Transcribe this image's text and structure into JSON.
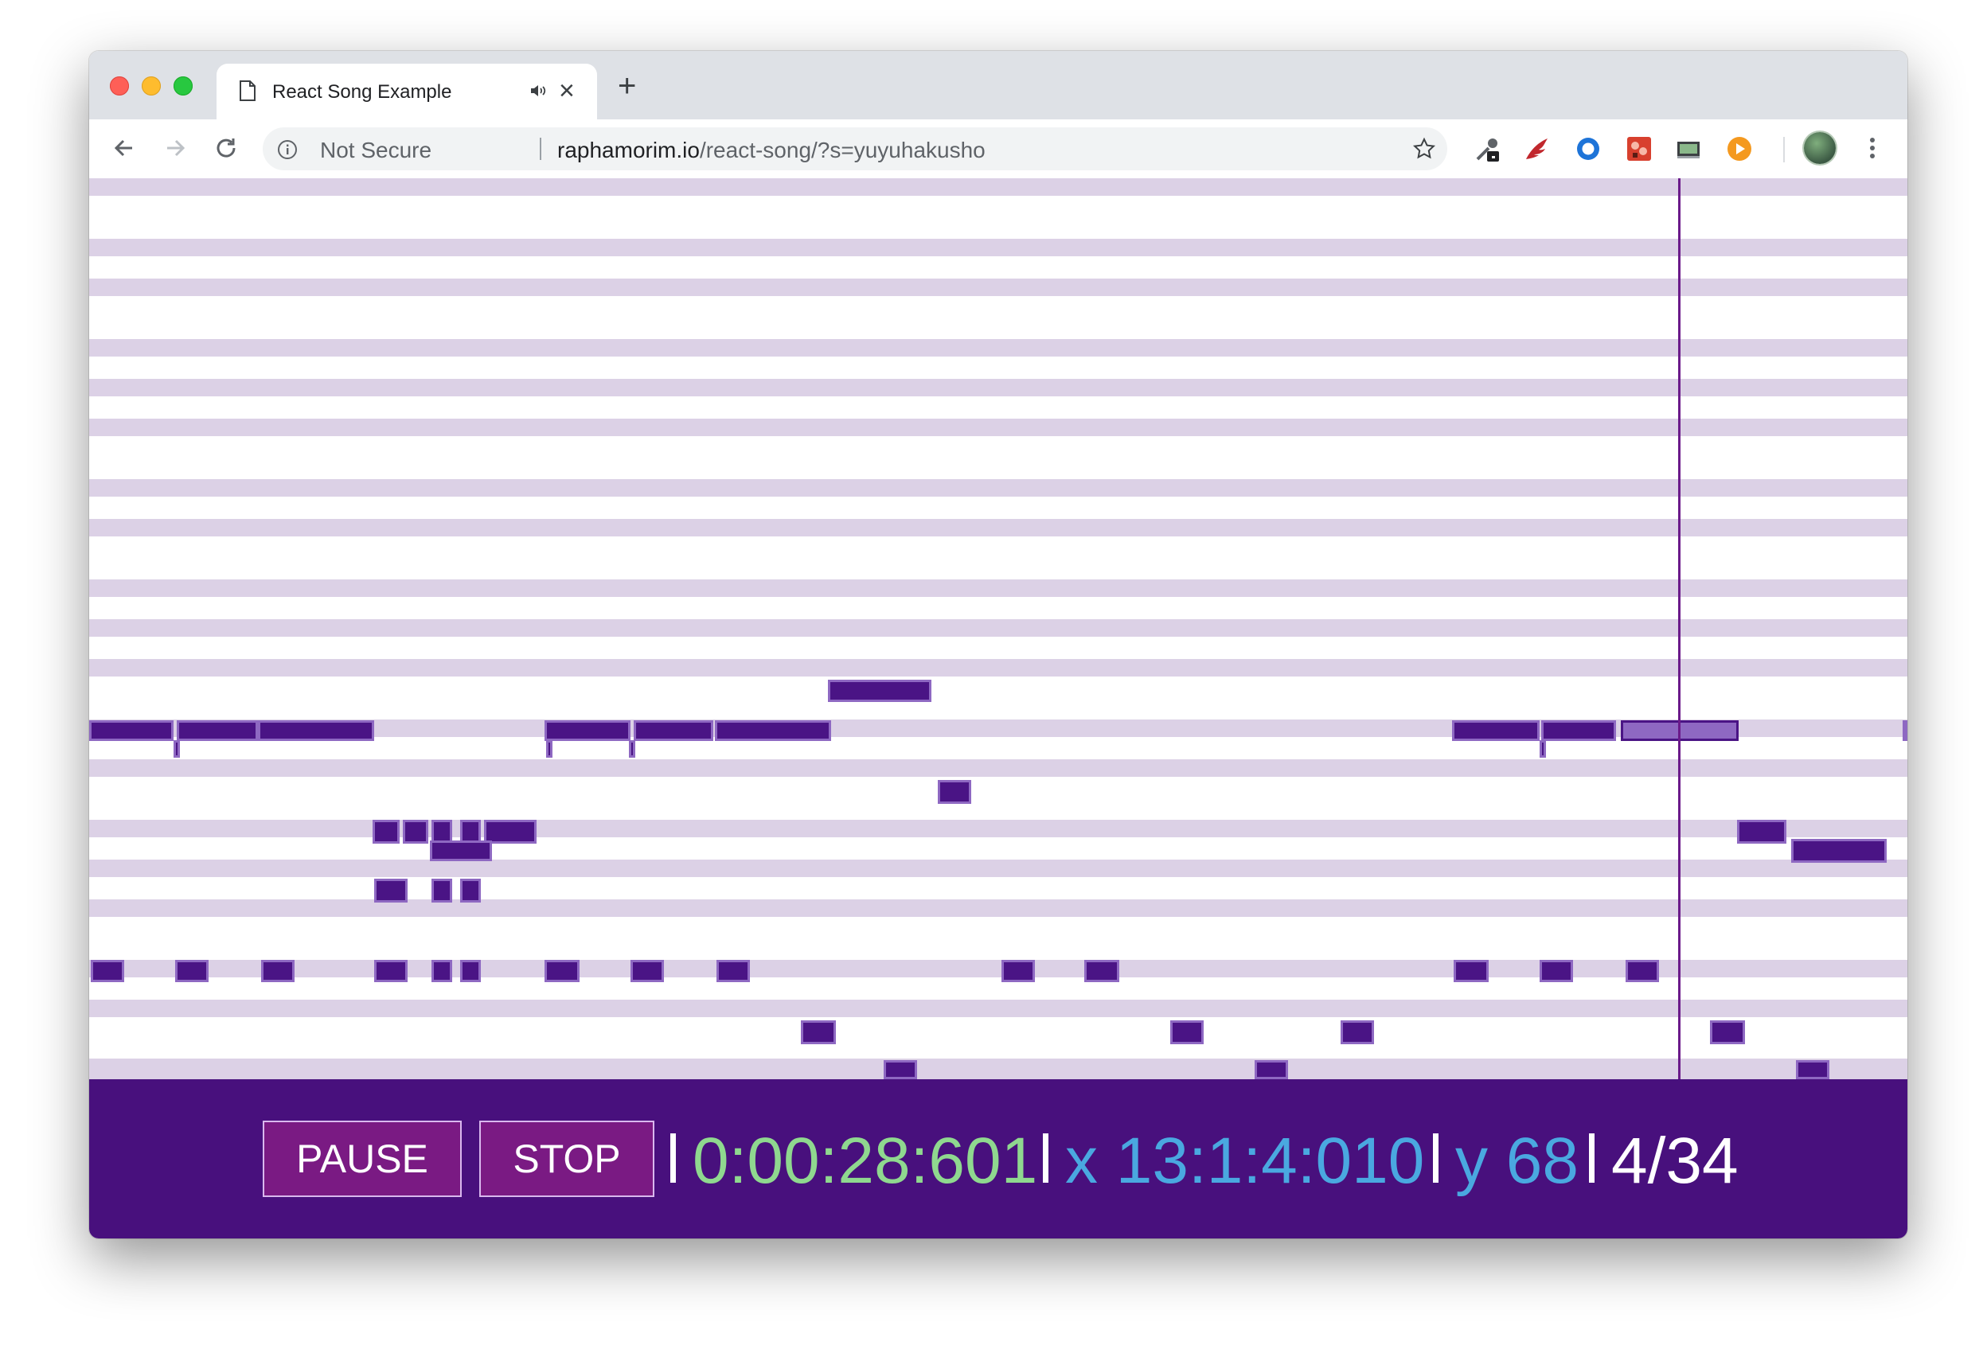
{
  "browser": {
    "tab": {
      "title": "React Song Example",
      "favicon": "page-icon",
      "audio_icon": "speaker-icon",
      "close_icon": "close-icon"
    },
    "new_tab_label": "+",
    "security_label": "Not Secure",
    "url_host": "raphamorim.io",
    "url_path": "/react-song/?s=yuyuhakusho",
    "nav_icons": [
      "back-arrow-icon",
      "forward-arrow-icon",
      "reload-icon"
    ],
    "extensions": [
      "eyedropper-icon",
      "wing-icon",
      "circle-icon",
      "sprite-icon",
      "monitor-icon",
      "play-icon"
    ]
  },
  "piano_roll": {
    "colors": {
      "lane": "#dcd1e6",
      "note_fill": "#4a1485",
      "note_border": "#8e68c2",
      "active_fill": "#8e68c2",
      "active_border": "#4a1485",
      "playhead": "#6b1a8a"
    },
    "playhead_time_fraction": 0.874,
    "visible_window_fraction_range": [
      0.0,
      1.0
    ],
    "pitch_rows_top_to_bottom": 45
  },
  "controls": {
    "pause_label": "PAUSE",
    "stop_label": "STOP",
    "time": "0:00:28:601",
    "x_position": "x 13:1:4:010",
    "y_value": "y 68",
    "count": "4/34",
    "colors": {
      "background": "#48107d",
      "time": "#8fd88f",
      "x": "#4aa8e0",
      "y": "#4aa8e0",
      "count": "#ffffff"
    }
  }
}
